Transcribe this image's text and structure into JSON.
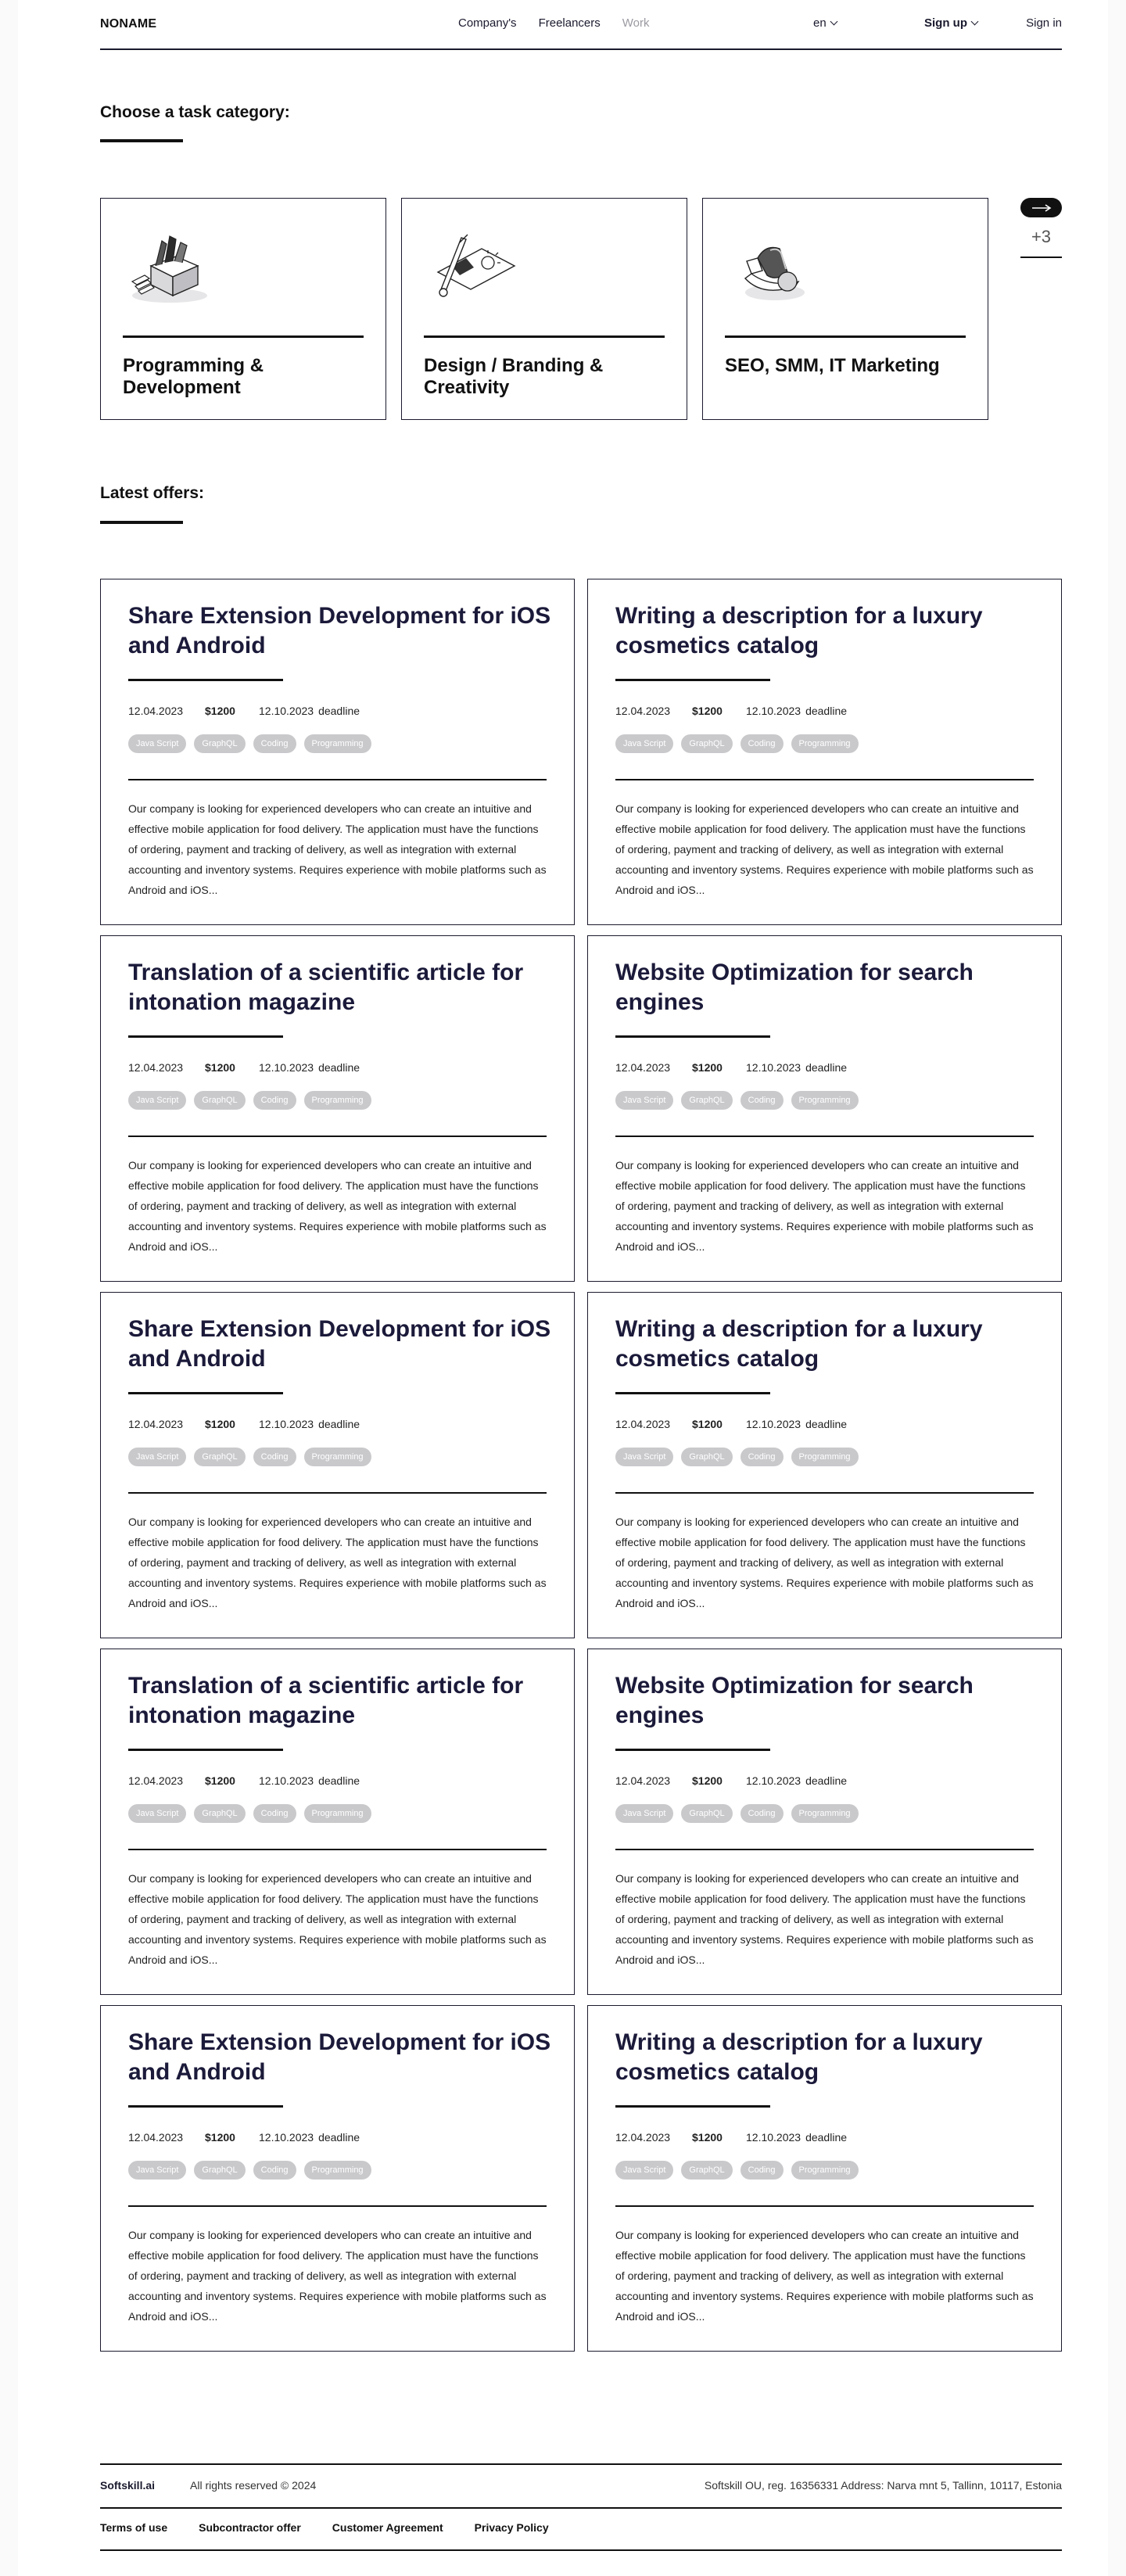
{
  "header": {
    "logo": "NONAME",
    "nav": [
      "Company's",
      "Freelancers",
      "Work"
    ],
    "lang": "en",
    "signup": "Sign up",
    "signin": "Sign in"
  },
  "categories_section": {
    "title": "Choose a task category:",
    "items": [
      {
        "label": "Programming & Development",
        "icon": "programming-illustration-icon"
      },
      {
        "label": "Design / Branding & Creativity",
        "icon": "design-illustration-icon"
      },
      {
        "label": "SEO, SMM, IT Marketing",
        "icon": "marketing-illustration-icon"
      }
    ],
    "more_count": "+3"
  },
  "offers_section": {
    "title": "Latest offers:",
    "offers": [
      {
        "title": "Share Extension Development for iOS and Android",
        "date": "12.04.2023",
        "price": "$1200",
        "deadline_date": "12.10.2023",
        "deadline_label": "deadline",
        "tags": [
          "Java Script",
          "GraphQL",
          "Coding",
          "Programming"
        ],
        "description": "Our company is looking for experienced developers who can create an intuitive and effective mobile application for food delivery. The application must have the functions of ordering, payment and tracking of delivery, as well as integration with external accounting and inventory systems. Requires experience with mobile platforms such as Android and iOS..."
      },
      {
        "title": "Writing a description for a luxury cosmetics catalog",
        "date": "12.04.2023",
        "price": "$1200",
        "deadline_date": "12.10.2023",
        "deadline_label": "deadline",
        "tags": [
          "Java Script",
          "GraphQL",
          "Coding",
          "Programming"
        ],
        "description": "Our company is looking for experienced developers who can create an intuitive and effective mobile application for food delivery. The application must have the functions of ordering, payment and tracking of delivery, as well as integration with external accounting and inventory systems. Requires experience with mobile platforms such as Android and iOS..."
      },
      {
        "title": "Translation of a scientific article for intonation magazine",
        "date": "12.04.2023",
        "price": "$1200",
        "deadline_date": "12.10.2023",
        "deadline_label": "deadline",
        "tags": [
          "Java Script",
          "GraphQL",
          "Coding",
          "Programming"
        ],
        "description": "Our company is looking for experienced developers who can create an intuitive and effective mobile application for food delivery. The application must have the functions of ordering, payment and tracking of delivery, as well as integration with external accounting and inventory systems. Requires experience with mobile platforms such as Android and iOS..."
      },
      {
        "title": "Website Optimization for search engines",
        "date": "12.04.2023",
        "price": "$1200",
        "deadline_date": "12.10.2023",
        "deadline_label": "deadline",
        "tags": [
          "Java Script",
          "GraphQL",
          "Coding",
          "Programming"
        ],
        "description": "Our company is looking for experienced developers who can create an intuitive and effective mobile application for food delivery. The application must have the functions of ordering, payment and tracking of delivery, as well as integration with external accounting and inventory systems. Requires experience with mobile platforms such as Android and iOS..."
      },
      {
        "title": "Share Extension Development for iOS and Android",
        "date": "12.04.2023",
        "price": "$1200",
        "deadline_date": "12.10.2023",
        "deadline_label": "deadline",
        "tags": [
          "Java Script",
          "GraphQL",
          "Coding",
          "Programming"
        ],
        "description": "Our company is looking for experienced developers who can create an intuitive and effective mobile application for food delivery. The application must have the functions of ordering, payment and tracking of delivery, as well as integration with external accounting and inventory systems. Requires experience with mobile platforms such as Android and iOS..."
      },
      {
        "title": "Writing a description for a luxury cosmetics catalog",
        "date": "12.04.2023",
        "price": "$1200",
        "deadline_date": "12.10.2023",
        "deadline_label": "deadline",
        "tags": [
          "Java Script",
          "GraphQL",
          "Coding",
          "Programming"
        ],
        "description": "Our company is looking for experienced developers who can create an intuitive and effective mobile application for food delivery. The application must have the functions of ordering, payment and tracking of delivery, as well as integration with external accounting and inventory systems. Requires experience with mobile platforms such as Android and iOS..."
      },
      {
        "title": "Translation of a scientific article for intonation magazine",
        "date": "12.04.2023",
        "price": "$1200",
        "deadline_date": "12.10.2023",
        "deadline_label": "deadline",
        "tags": [
          "Java Script",
          "GraphQL",
          "Coding",
          "Programming"
        ],
        "description": "Our company is looking for experienced developers who can create an intuitive and effective mobile application for food delivery. The application must have the functions of ordering, payment and tracking of delivery, as well as integration with external accounting and inventory systems. Requires experience with mobile platforms such as Android and iOS..."
      },
      {
        "title": "Website Optimization for search engines",
        "date": "12.04.2023",
        "price": "$1200",
        "deadline_date": "12.10.2023",
        "deadline_label": "deadline",
        "tags": [
          "Java Script",
          "GraphQL",
          "Coding",
          "Programming"
        ],
        "description": "Our company is looking for experienced developers who can create an intuitive and effective mobile application for food delivery. The application must have the functions of ordering, payment and tracking of delivery, as well as integration with external accounting and inventory systems. Requires experience with mobile platforms such as Android and iOS..."
      },
      {
        "title": "Share Extension Development for iOS and Android",
        "date": "12.04.2023",
        "price": "$1200",
        "deadline_date": "12.10.2023",
        "deadline_label": "deadline",
        "tags": [
          "Java Script",
          "GraphQL",
          "Coding",
          "Programming"
        ],
        "description": "Our company is looking for experienced developers who can create an intuitive and effective mobile application for food delivery. The application must have the functions of ordering, payment and tracking of delivery, as well as integration with external accounting and inventory systems. Requires experience with mobile platforms such as Android and iOS..."
      },
      {
        "title": "Writing a description for a luxury cosmetics catalog",
        "date": "12.04.2023",
        "price": "$1200",
        "deadline_date": "12.10.2023",
        "deadline_label": "deadline",
        "tags": [
          "Java Script",
          "GraphQL",
          "Coding",
          "Programming"
        ],
        "description": "Our company is looking for experienced developers who can create an intuitive and effective mobile application for food delivery. The application must have the functions of ordering, payment and tracking of delivery, as well as integration with external accounting and inventory systems. Requires experience with mobile platforms such as Android and iOS..."
      }
    ]
  },
  "footer": {
    "brand": "Softskill.ai",
    "rights": "All rights reserved © 2024",
    "address": "Softskill OU, reg. 16356331 Address: Narva mnt 5, Tallinn, 10117, Estonia",
    "links": [
      "Terms of use",
      "Subcontractor offer",
      "Customer Agreement",
      "Privacy Policy"
    ]
  }
}
